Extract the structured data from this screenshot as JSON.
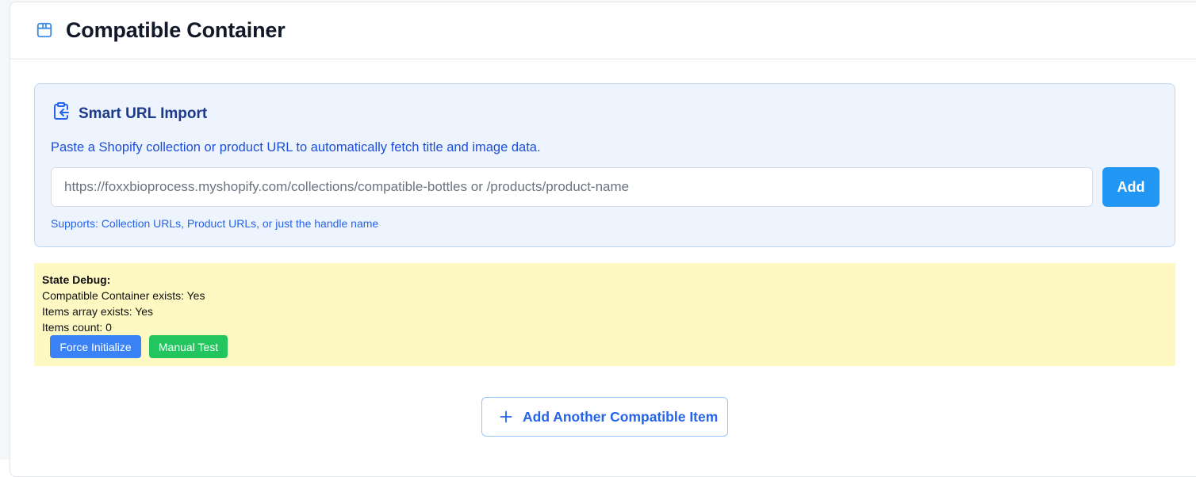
{
  "header": {
    "title": "Compatible Container",
    "icon": "package-icon"
  },
  "import": {
    "icon": "clipboard-import-icon",
    "title": "Smart URL Import",
    "description": "Paste a Shopify collection or product URL to automatically fetch title and image data.",
    "input_value": "",
    "input_placeholder": "https://foxxbioprocess.myshopify.com/collections/compatible-bottles or /products/product-name",
    "add_label": "Add",
    "note": "Supports: Collection URLs, Product URLs, or just the handle name"
  },
  "debug": {
    "title": "State Debug:",
    "lines": [
      "Compatible Container exists: Yes",
      "Items array exists: Yes",
      "Items count: 0"
    ],
    "force_label": "Force Initialize",
    "manual_label": "Manual Test"
  },
  "add_another": {
    "icon": "plus-icon",
    "label": "Add Another Compatible Item"
  },
  "colors": {
    "accent": "#2196f3",
    "panel_bg": "#edf4fe",
    "debug_bg": "#fef9c3",
    "force_button": "#3b82f6",
    "manual_button": "#22c55e"
  }
}
